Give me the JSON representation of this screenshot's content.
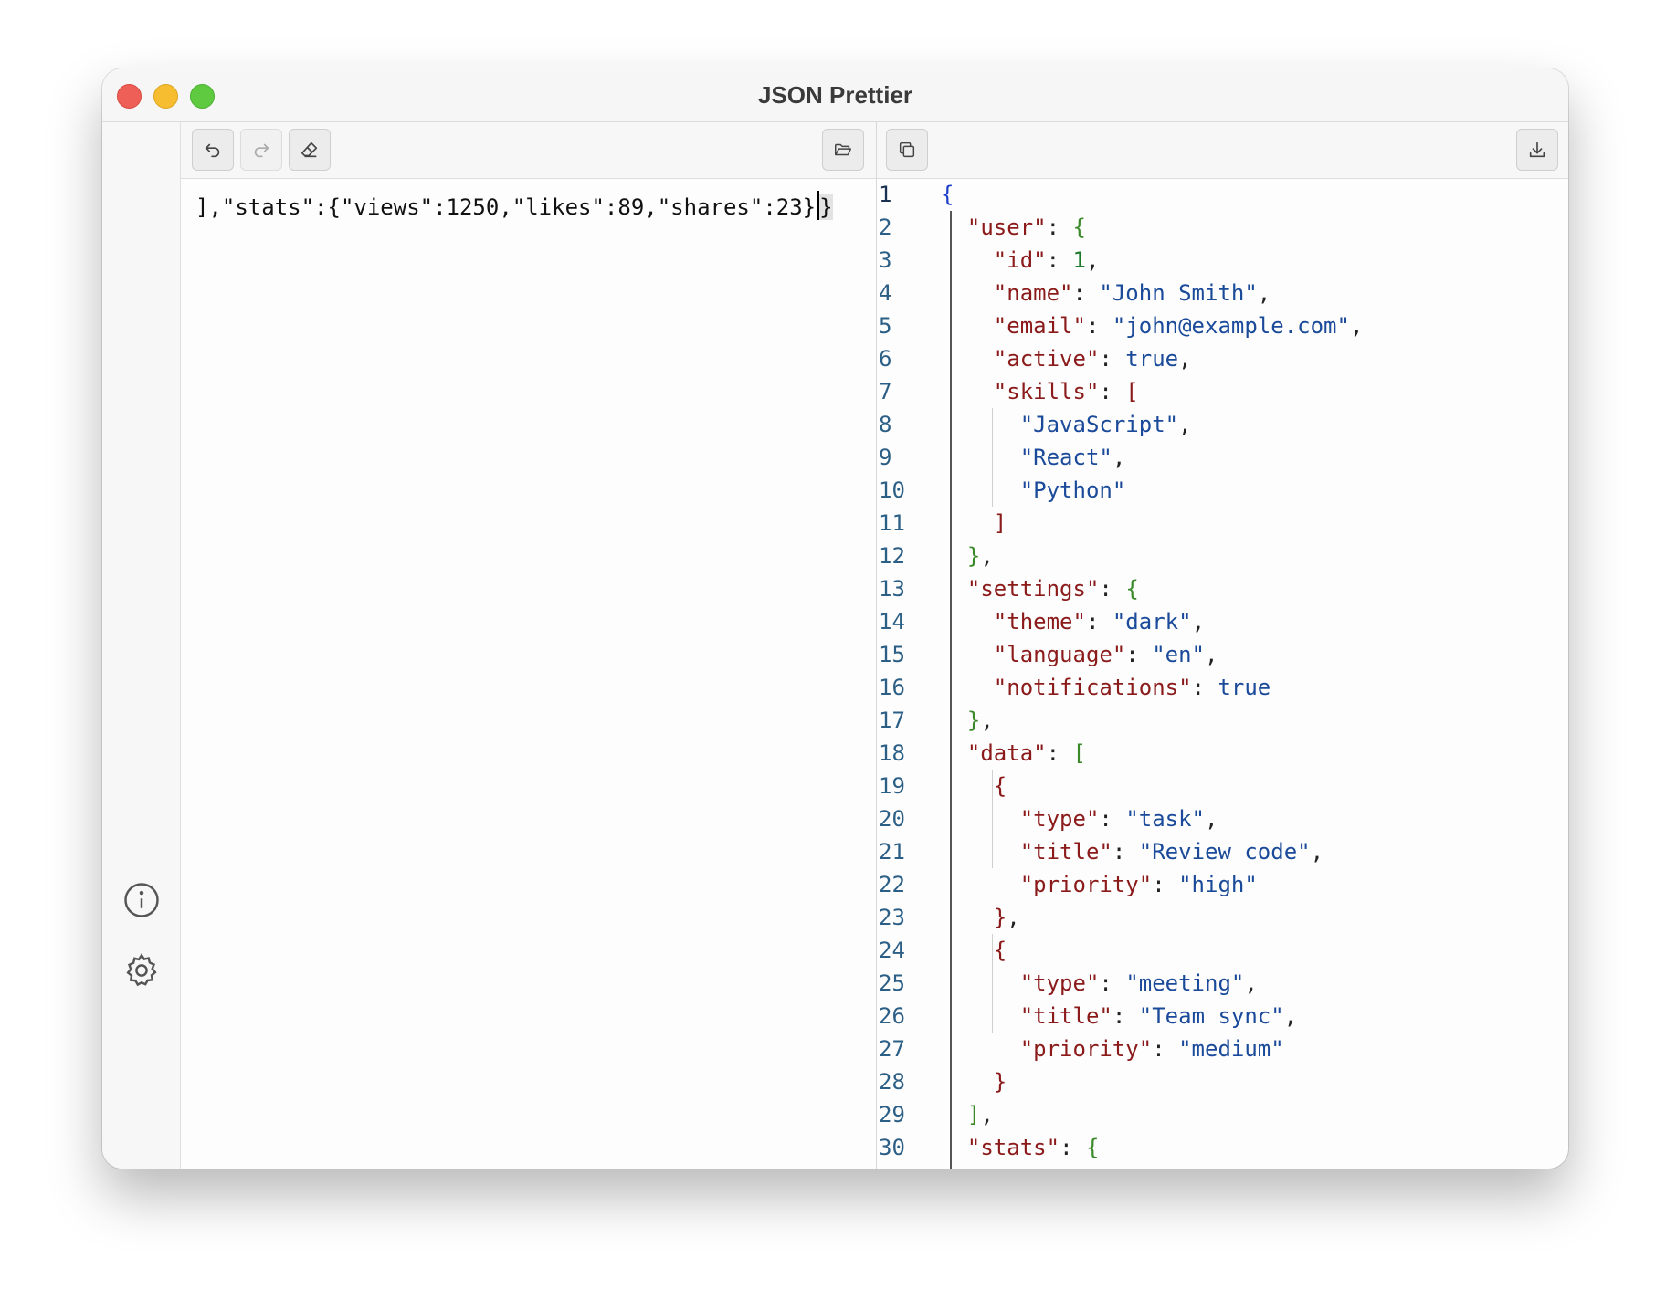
{
  "window": {
    "title": "JSON Prettier"
  },
  "input": {
    "text_before_cursor": "],\"stats\":{\"views\":1250,\"likes\":89,\"shares\":23}",
    "text_after_cursor": "}"
  },
  "toolbar_left": {
    "undo": "undo-icon",
    "redo": "redo-icon",
    "clear": "eraser-icon",
    "open": "folder-open-icon"
  },
  "toolbar_right": {
    "copy": "copy-icon",
    "download": "download-icon"
  },
  "sidebar": {
    "info": "info-icon",
    "settings": "gear-icon"
  },
  "output": {
    "line_numbers": [
      "1",
      "2",
      "3",
      "4",
      "5",
      "6",
      "7",
      "8",
      "9",
      "10",
      "11",
      "12",
      "13",
      "14",
      "15",
      "16",
      "17",
      "18",
      "19",
      "20",
      "21",
      "22",
      "23",
      "24",
      "25",
      "26",
      "27",
      "28",
      "29",
      "30"
    ],
    "lines": [
      "{",
      "  \"user\": {",
      "    \"id\": 1,",
      "    \"name\": \"John Smith\",",
      "    \"email\": \"john@example.com\",",
      "    \"active\": true,",
      "    \"skills\": [",
      "      \"JavaScript\",",
      "      \"React\",",
      "      \"Python\"",
      "    ]",
      "  },",
      "  \"settings\": {",
      "    \"theme\": \"dark\",",
      "    \"language\": \"en\",",
      "    \"notifications\": true",
      "  },",
      "  \"data\": [",
      "    {",
      "      \"type\": \"task\",",
      "      \"title\": \"Review code\",",
      "      \"priority\": \"high\"",
      "    },",
      "    {",
      "      \"type\": \"meeting\",",
      "      \"title\": \"Team sync\",",
      "      \"priority\": \"medium\"",
      "    }",
      "  ],",
      "  \"stats\": {"
    ]
  },
  "colors": {
    "key": "#8b1a1a",
    "string": "#1a4a99",
    "number": "#1a7a2a",
    "boolean": "#1a4a99",
    "line_number": "#2c5f86"
  }
}
